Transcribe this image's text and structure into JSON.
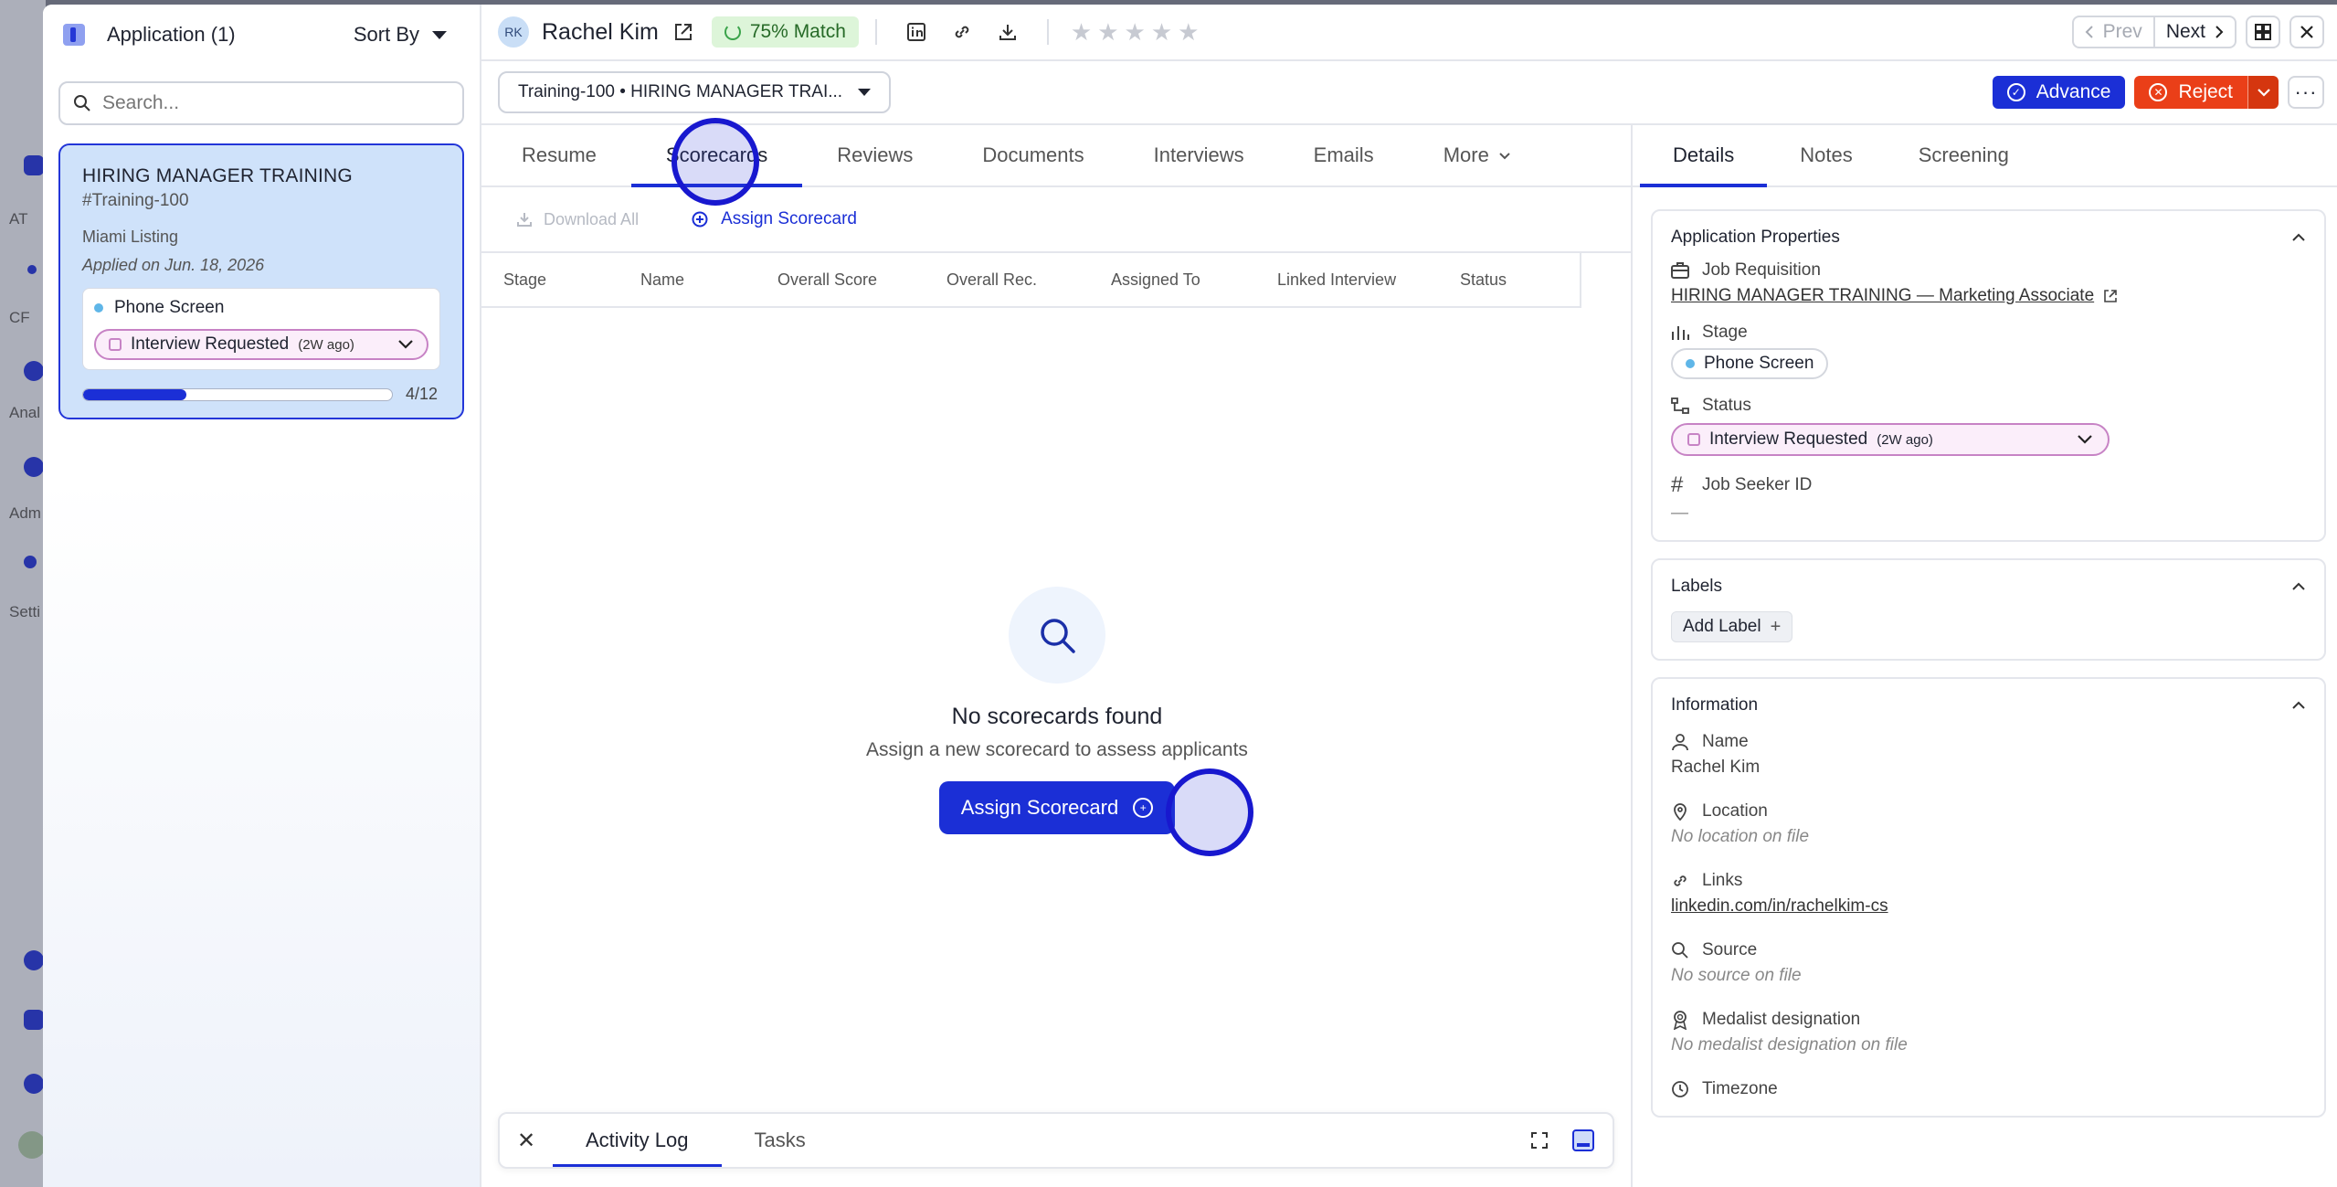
{
  "left_panel": {
    "title": "Application (1)",
    "sort_label": "Sort By",
    "search_placeholder": "Search...",
    "card": {
      "job_title": "HIRING MANAGER TRAINING",
      "requisition": "#Training-100",
      "location": "Miami Listing",
      "applied": "Applied on Jun. 18, 2026",
      "stage": "Phone Screen",
      "status": "Interview Requested",
      "status_ago": "(2W ago)",
      "progress_label": "4/12",
      "progress_fraction": 0.333
    }
  },
  "header": {
    "initials": "RK",
    "candidate_name": "Rachel Kim",
    "match_label": "75% Match",
    "rating_stars": 0,
    "prev_label": "Prev",
    "next_label": "Next"
  },
  "subheader": {
    "requisition_select": "Training-100 • HIRING MANAGER TRAI...",
    "advance_label": "Advance",
    "reject_label": "Reject"
  },
  "main_tabs": [
    "Resume",
    "Scorecards",
    "Reviews",
    "Documents",
    "Interviews",
    "Emails",
    "More"
  ],
  "active_main_tab": "Scorecards",
  "scorecards": {
    "download_all": "Download All",
    "assign_scorecard": "Assign Scorecard",
    "columns": [
      "Stage",
      "Name",
      "Overall Score",
      "Overall Rec.",
      "Assigned To",
      "Linked Interview",
      "Status"
    ],
    "empty_title": "No scorecards found",
    "empty_subtitle": "Assign a new scorecard to assess applicants",
    "cta_label": "Assign Scorecard"
  },
  "activity_bar": {
    "tabs": [
      "Activity Log",
      "Tasks"
    ]
  },
  "right_tabs": [
    "Details",
    "Notes",
    "Screening"
  ],
  "details": {
    "app_props_title": "Application Properties",
    "job_req_label": "Job Requisition",
    "job_req_value": "HIRING MANAGER TRAINING — Marketing Associate",
    "stage_label": "Stage",
    "stage_value": "Phone Screen",
    "status_label": "Status",
    "status_value": "Interview Requested",
    "status_ago": "(2W ago)",
    "seeker_id_label": "Job Seeker ID",
    "seeker_id_value": "—",
    "labels_title": "Labels",
    "add_label": "Add Label",
    "info_title": "Information",
    "name_label": "Name",
    "name_value": "Rachel Kim",
    "location_label": "Location",
    "location_value": "No location on file",
    "links_label": "Links",
    "links_value": "linkedin.com/in/rachelkim-cs",
    "source_label": "Source",
    "source_value": "No source on file",
    "medalist_label": "Medalist designation",
    "medalist_value": "No medalist designation on file",
    "timezone_label": "Timezone"
  },
  "background_sidebar": [
    "AT",
    "CF",
    "Anal",
    "Adm",
    "Setti"
  ],
  "colors": {
    "primary": "#1b2fd6",
    "reject": "#ea3f18",
    "match_bg": "#ddf5d9",
    "status_pill": "#c783c5",
    "card_bg": "#cfe2fa"
  }
}
